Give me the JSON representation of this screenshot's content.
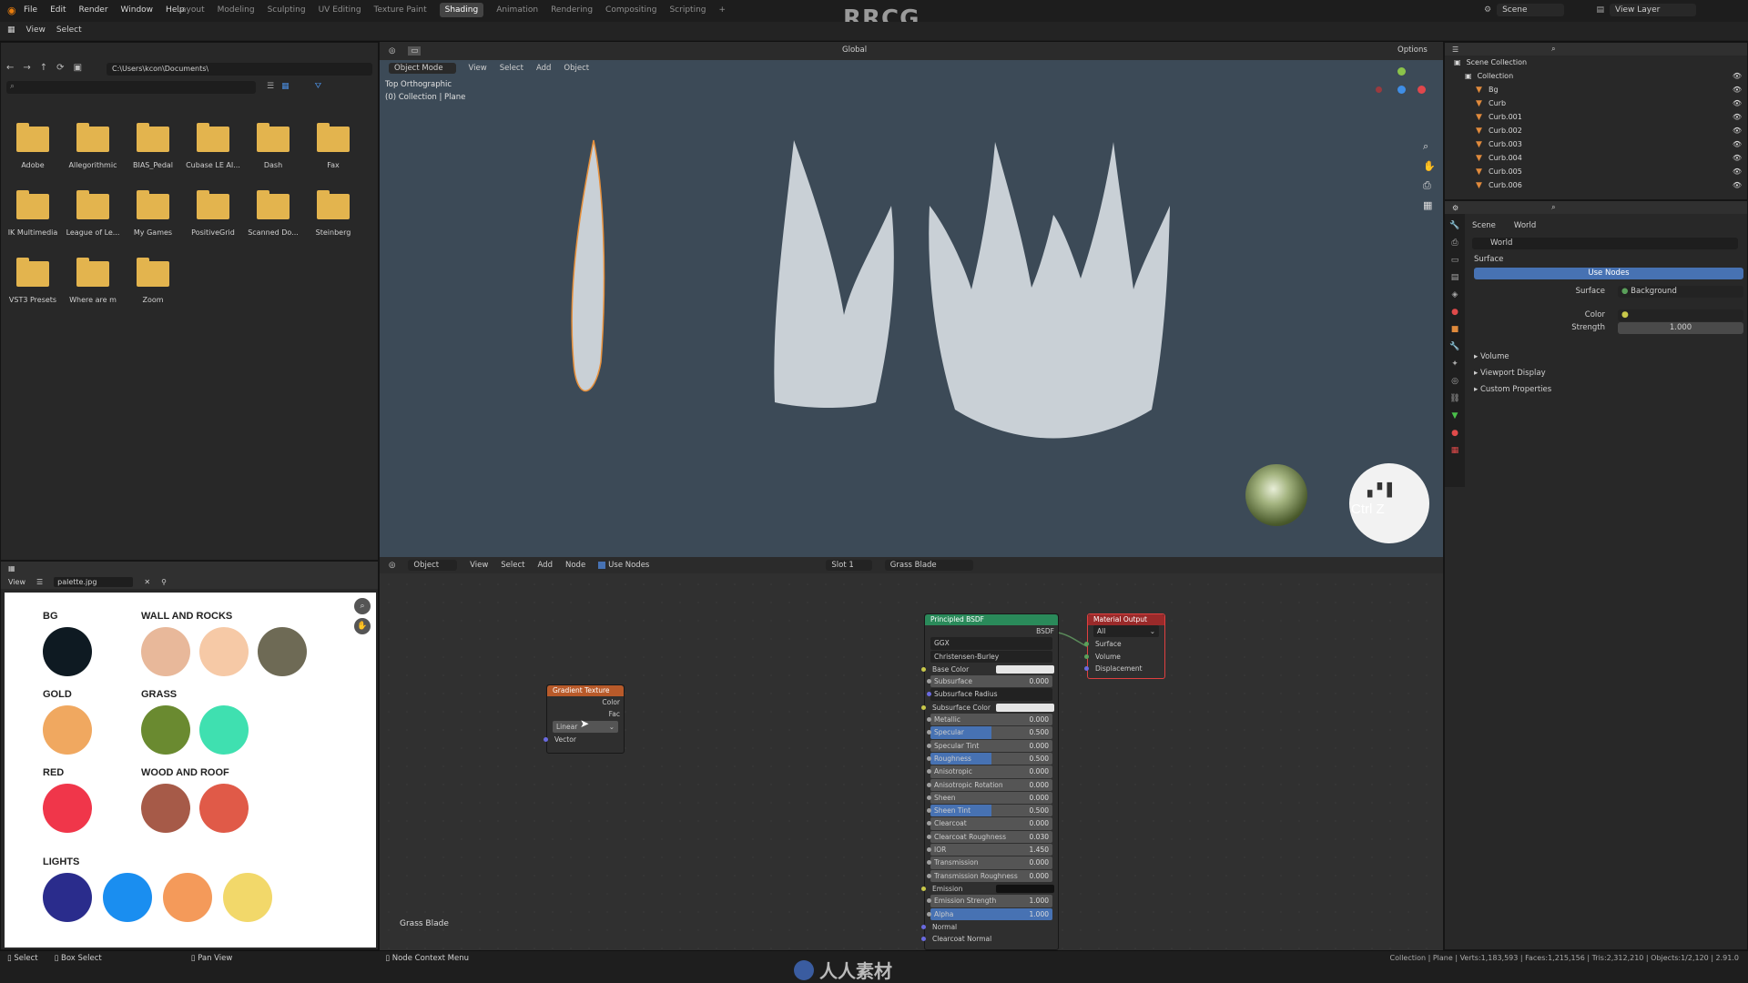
{
  "app": {
    "brand": "RRCG",
    "menu": [
      "File",
      "Edit",
      "Render",
      "Window",
      "Help"
    ],
    "workspaces": [
      "Layout",
      "Modeling",
      "Sculpting",
      "UV Editing",
      "Texture Paint",
      "Shading",
      "Animation",
      "Rendering",
      "Compositing",
      "Scripting"
    ],
    "active_workspace": "Shading",
    "scene": "Scene",
    "view_layer": "View Layer"
  },
  "file_browser": {
    "header": [
      "View",
      "Select"
    ],
    "path": "C:\\Users\\kcon\\Documents\\",
    "folders": [
      "Adobe",
      "Allegorithmic",
      "BIAS_Pedal",
      "Cubase LE AI...",
      "Dash",
      "Fax",
      "IK Multimedia",
      "League of Le...",
      "My Games",
      "PositiveGrid",
      "Scanned Do...",
      "Steinberg",
      "VST3 Presets",
      "Where are m",
      "Zoom"
    ]
  },
  "viewport": {
    "mode": "Object Mode",
    "menus": [
      "View",
      "Select",
      "Add",
      "Object"
    ],
    "orientation": "Global",
    "options": "Options",
    "info_line1": "Top Orthographic",
    "info_line2": "(0) Collection | Plane",
    "shortcut": "Ctrl Z"
  },
  "image_editor": {
    "view": "View",
    "image": "palette.jpg",
    "groups": [
      {
        "title": "BG"
      },
      {
        "title": "WALL AND ROCKS"
      },
      {
        "title": "GOLD"
      },
      {
        "title": "GRASS"
      },
      {
        "title": "RED"
      },
      {
        "title": "WOOD AND ROOF"
      },
      {
        "title": "LIGHTS"
      }
    ],
    "colors": {
      "bg": "#0e1a22",
      "wall1": "#e8b89a",
      "wall2": "#f6c9a6",
      "wall3": "#6e6a55",
      "gold": "#f0a860",
      "grass1": "#6a8a30",
      "grass2": "#3fe0b0",
      "red": "#f0364a",
      "wood1": "#a65a48",
      "wood2": "#e05a48",
      "l1": "#2a2c8c",
      "l2": "#1a8ef0",
      "l3": "#f49a5a",
      "l4": "#f2d86a"
    }
  },
  "node_editor": {
    "type": "Object",
    "menus": [
      "View",
      "Select",
      "Add",
      "Node"
    ],
    "use_nodes": "Use Nodes",
    "slot": "Slot 1",
    "material": "Grass Blade",
    "label": "Grass Blade",
    "gradient": {
      "title": "Gradient Texture",
      "out1": "Color",
      "out2": "Fac",
      "interp": "Linear",
      "in": "Vector"
    },
    "bsdf": {
      "title": "Principled BSDF",
      "out": "BSDF",
      "dist": "GGX",
      "sss": "Christensen-Burley",
      "rows": [
        [
          "Base Color",
          ""
        ],
        [
          "Subsurface",
          "0.000"
        ],
        [
          "Subsurface Radius",
          ""
        ],
        [
          "Subsurface Color",
          ""
        ],
        [
          "Metallic",
          "0.000"
        ],
        [
          "Specular",
          "0.500"
        ],
        [
          "Specular Tint",
          "0.000"
        ],
        [
          "Roughness",
          "0.500"
        ],
        [
          "Anisotropic",
          "0.000"
        ],
        [
          "Anisotropic Rotation",
          "0.000"
        ],
        [
          "Sheen",
          "0.000"
        ],
        [
          "Sheen Tint",
          "0.500"
        ],
        [
          "Clearcoat",
          "0.000"
        ],
        [
          "Clearcoat Roughness",
          "0.030"
        ],
        [
          "IOR",
          "1.450"
        ],
        [
          "Transmission",
          "0.000"
        ],
        [
          "Transmission Roughness",
          "0.000"
        ],
        [
          "Emission",
          ""
        ],
        [
          "Emission Strength",
          "1.000"
        ],
        [
          "Alpha",
          "1.000"
        ],
        [
          "Normal",
          ""
        ],
        [
          "Clearcoat Normal",
          ""
        ]
      ]
    },
    "output": {
      "title": "Material Output",
      "target": "All",
      "in": [
        "Surface",
        "Volume",
        "Displacement"
      ]
    }
  },
  "outliner": {
    "root": "Scene Collection",
    "collection": "Collection",
    "items": [
      "Bg",
      "Curb",
      "Curb.001",
      "Curb.002",
      "Curb.003",
      "Curb.004",
      "Curb.005",
      "Curb.006"
    ]
  },
  "properties": {
    "tab_scene": "Scene",
    "tab_world": "World",
    "world": "World",
    "surface": "Surface",
    "use_nodes": "Use Nodes",
    "surface_label": "Surface",
    "surface_value": "Background",
    "color_label": "Color",
    "strength_label": "Strength",
    "strength": "1.000",
    "sections": [
      "Volume",
      "Viewport Display",
      "Custom Properties"
    ]
  },
  "status": {
    "select": "Select",
    "box": "Box Select",
    "pan": "Pan View",
    "ctx": "Node Context Menu",
    "right": "Collection | Plane | Verts:1,183,593 | Faces:1,215,156 | Tris:2,312,210 | Objects:1/2,120 | 2.91.0",
    "watermark": "人人素材"
  }
}
